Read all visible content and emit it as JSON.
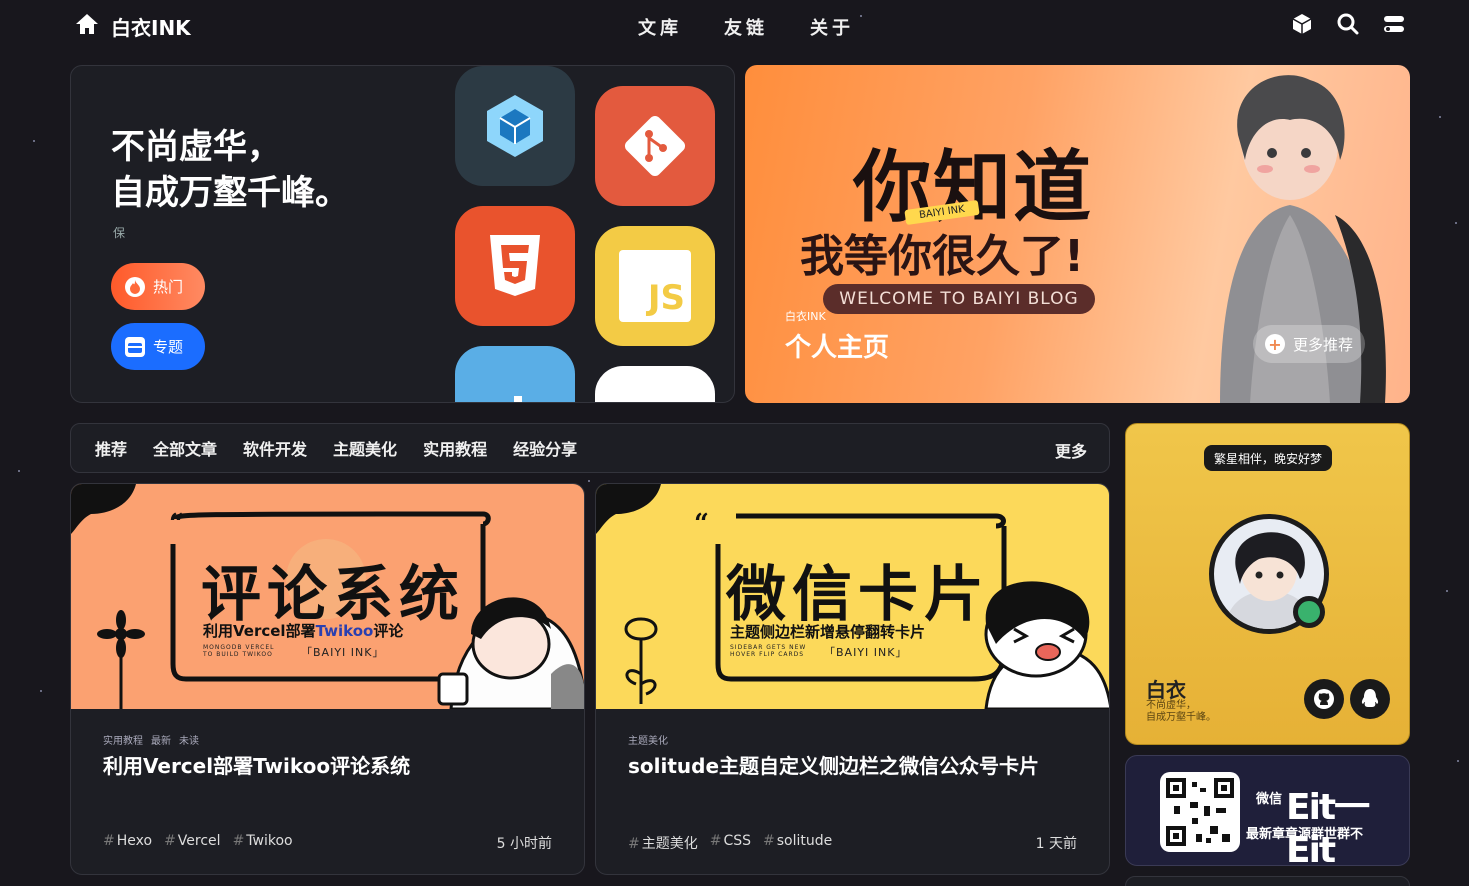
{
  "brand": {
    "name": "白衣INK"
  },
  "nav": {
    "items": [
      "文库",
      "友链",
      "关于"
    ]
  },
  "hero_left": {
    "slogan": "不尚虚华，\n自成万壑千峰。",
    "sub": "保",
    "pill_hot": "热门",
    "pill_topic": "专题"
  },
  "hero_right": {
    "big": "你知道",
    "mid": "我等你很久了!",
    "tag": "BAIYI INK",
    "welcome": "WELCOME TO BAIYI BLOG",
    "label": "白衣INK",
    "title": "个人主页",
    "more": "更多推荐"
  },
  "categories": {
    "items": [
      "推荐",
      "全部文章",
      "软件开发",
      "主题美化",
      "实用教程",
      "经验分享"
    ],
    "more": "更多"
  },
  "posts": [
    {
      "cover_title": "评论系统",
      "cover_sub_pre": "利用Vercel部署",
      "cover_sub_hl": "Twikoo",
      "cover_sub_post": "评论",
      "cover_small": "MONGODB VERCEL\nTO BUILD TWIKOO",
      "cover_tag": "「BAIYI INK」",
      "meta": [
        "实用教程",
        "最新",
        "未读"
      ],
      "title": "利用Vercel部署Twikoo评论系统",
      "tags": [
        "Hexo",
        "Vercel",
        "Twikoo"
      ],
      "time": "5 小时前",
      "bg": "#fba171"
    },
    {
      "cover_title": "微信卡片",
      "cover_sub": "主题侧边栏新增悬停翻转卡片",
      "cover_small": "SIDEBAR GETS NEW\nHOVER FLIP CARDS",
      "cover_tag": "「BAIYI INK」",
      "meta": [
        "主题美化"
      ],
      "title": "solitude主题自定义侧边栏之微信公众号卡片",
      "tags": [
        "主题美化",
        "CSS",
        "solitude"
      ],
      "time": "1 天前",
      "bg": "#fcd95a"
    }
  ],
  "profile": {
    "greeting": "繁星相伴，晚安好梦",
    "name": "白衣",
    "desc": "不尚虚华，\n自成万壑千峰。"
  },
  "wechat": {
    "label": "微信",
    "big": "Eit一Eit",
    "sub": "最新章章源群世群不"
  },
  "colors": {
    "accent_orange": "#ff7a45",
    "accent_blue": "#1b6dff",
    "profile_bg": "#f0c64a"
  },
  "icons": [
    "home-icon",
    "cube-icon",
    "search-icon",
    "toggle-icon",
    "fire-icon",
    "calendar-icon",
    "plus-icon",
    "github-icon",
    "qq-icon"
  ]
}
